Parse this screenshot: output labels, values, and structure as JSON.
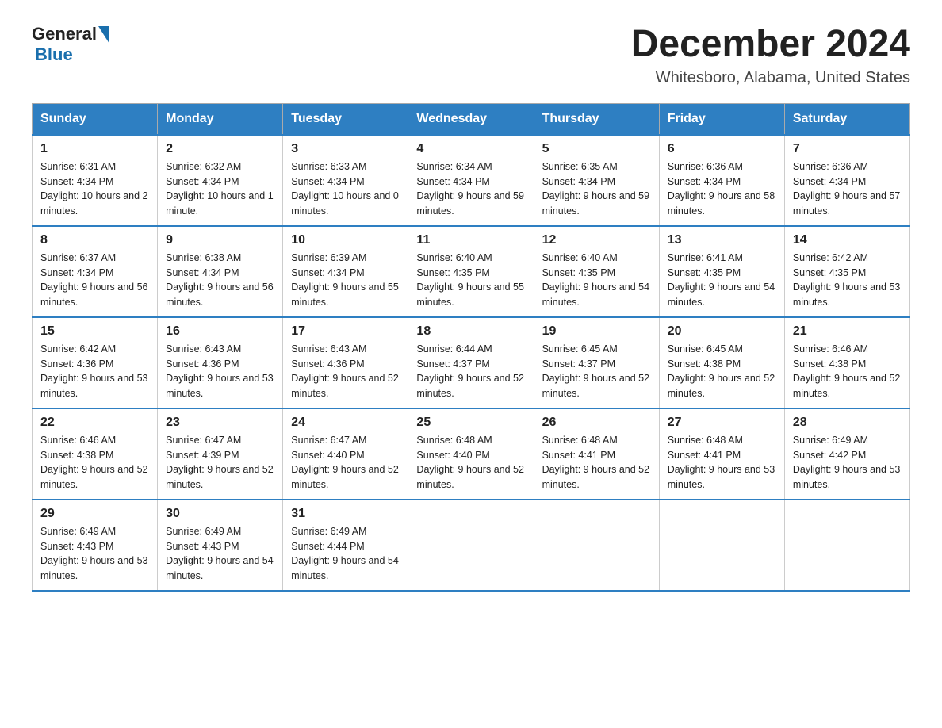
{
  "header": {
    "logo_general": "General",
    "logo_blue": "Blue",
    "month": "December 2024",
    "location": "Whitesboro, Alabama, United States"
  },
  "weekdays": [
    "Sunday",
    "Monday",
    "Tuesday",
    "Wednesday",
    "Thursday",
    "Friday",
    "Saturday"
  ],
  "weeks": [
    [
      {
        "day": "1",
        "sunrise": "6:31 AM",
        "sunset": "4:34 PM",
        "daylight": "10 hours and 2 minutes."
      },
      {
        "day": "2",
        "sunrise": "6:32 AM",
        "sunset": "4:34 PM",
        "daylight": "10 hours and 1 minute."
      },
      {
        "day": "3",
        "sunrise": "6:33 AM",
        "sunset": "4:34 PM",
        "daylight": "10 hours and 0 minutes."
      },
      {
        "day": "4",
        "sunrise": "6:34 AM",
        "sunset": "4:34 PM",
        "daylight": "9 hours and 59 minutes."
      },
      {
        "day": "5",
        "sunrise": "6:35 AM",
        "sunset": "4:34 PM",
        "daylight": "9 hours and 59 minutes."
      },
      {
        "day": "6",
        "sunrise": "6:36 AM",
        "sunset": "4:34 PM",
        "daylight": "9 hours and 58 minutes."
      },
      {
        "day": "7",
        "sunrise": "6:36 AM",
        "sunset": "4:34 PM",
        "daylight": "9 hours and 57 minutes."
      }
    ],
    [
      {
        "day": "8",
        "sunrise": "6:37 AM",
        "sunset": "4:34 PM",
        "daylight": "9 hours and 56 minutes."
      },
      {
        "day": "9",
        "sunrise": "6:38 AM",
        "sunset": "4:34 PM",
        "daylight": "9 hours and 56 minutes."
      },
      {
        "day": "10",
        "sunrise": "6:39 AM",
        "sunset": "4:34 PM",
        "daylight": "9 hours and 55 minutes."
      },
      {
        "day": "11",
        "sunrise": "6:40 AM",
        "sunset": "4:35 PM",
        "daylight": "9 hours and 55 minutes."
      },
      {
        "day": "12",
        "sunrise": "6:40 AM",
        "sunset": "4:35 PM",
        "daylight": "9 hours and 54 minutes."
      },
      {
        "day": "13",
        "sunrise": "6:41 AM",
        "sunset": "4:35 PM",
        "daylight": "9 hours and 54 minutes."
      },
      {
        "day": "14",
        "sunrise": "6:42 AM",
        "sunset": "4:35 PM",
        "daylight": "9 hours and 53 minutes."
      }
    ],
    [
      {
        "day": "15",
        "sunrise": "6:42 AM",
        "sunset": "4:36 PM",
        "daylight": "9 hours and 53 minutes."
      },
      {
        "day": "16",
        "sunrise": "6:43 AM",
        "sunset": "4:36 PM",
        "daylight": "9 hours and 53 minutes."
      },
      {
        "day": "17",
        "sunrise": "6:43 AM",
        "sunset": "4:36 PM",
        "daylight": "9 hours and 52 minutes."
      },
      {
        "day": "18",
        "sunrise": "6:44 AM",
        "sunset": "4:37 PM",
        "daylight": "9 hours and 52 minutes."
      },
      {
        "day": "19",
        "sunrise": "6:45 AM",
        "sunset": "4:37 PM",
        "daylight": "9 hours and 52 minutes."
      },
      {
        "day": "20",
        "sunrise": "6:45 AM",
        "sunset": "4:38 PM",
        "daylight": "9 hours and 52 minutes."
      },
      {
        "day": "21",
        "sunrise": "6:46 AM",
        "sunset": "4:38 PM",
        "daylight": "9 hours and 52 minutes."
      }
    ],
    [
      {
        "day": "22",
        "sunrise": "6:46 AM",
        "sunset": "4:38 PM",
        "daylight": "9 hours and 52 minutes."
      },
      {
        "day": "23",
        "sunrise": "6:47 AM",
        "sunset": "4:39 PM",
        "daylight": "9 hours and 52 minutes."
      },
      {
        "day": "24",
        "sunrise": "6:47 AM",
        "sunset": "4:40 PM",
        "daylight": "9 hours and 52 minutes."
      },
      {
        "day": "25",
        "sunrise": "6:48 AM",
        "sunset": "4:40 PM",
        "daylight": "9 hours and 52 minutes."
      },
      {
        "day": "26",
        "sunrise": "6:48 AM",
        "sunset": "4:41 PM",
        "daylight": "9 hours and 52 minutes."
      },
      {
        "day": "27",
        "sunrise": "6:48 AM",
        "sunset": "4:41 PM",
        "daylight": "9 hours and 53 minutes."
      },
      {
        "day": "28",
        "sunrise": "6:49 AM",
        "sunset": "4:42 PM",
        "daylight": "9 hours and 53 minutes."
      }
    ],
    [
      {
        "day": "29",
        "sunrise": "6:49 AM",
        "sunset": "4:43 PM",
        "daylight": "9 hours and 53 minutes."
      },
      {
        "day": "30",
        "sunrise": "6:49 AM",
        "sunset": "4:43 PM",
        "daylight": "9 hours and 54 minutes."
      },
      {
        "day": "31",
        "sunrise": "6:49 AM",
        "sunset": "4:44 PM",
        "daylight": "9 hours and 54 minutes."
      },
      null,
      null,
      null,
      null
    ]
  ]
}
